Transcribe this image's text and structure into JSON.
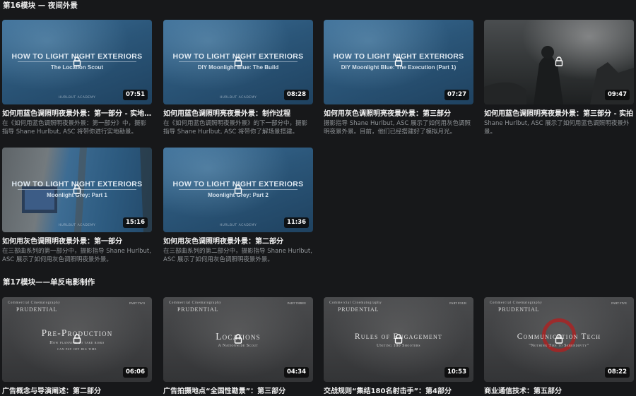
{
  "modules": [
    {
      "title": "第16模块 — 夜间外景",
      "videos": [
        {
          "title": "如何用蓝色调照明夜景外景：第一部分 - 实地勘景",
          "desc": "在《如何用蓝色调照明夜景外景：第一部分》中，摄影指导 Shane Hurlbut, ASC 将带你进行实地勘景。",
          "duration": "07:51",
          "thumb_style": "blue",
          "thumb_title": "HOW TO LIGHT NIGHT EXTERIORS",
          "thumb_sub": "The Location Scout",
          "thumb_brand": "HURLBUT ACADEMY"
        },
        {
          "title": "如何用蓝色调照明亮夜景外景：制作过程",
          "desc": "在《如何用蓝色调照明夜景外景》的下一部分中，摄影指导 Shane Hurlbut, ASC 将带你了解场景搭建。",
          "duration": "08:28",
          "thumb_style": "blue",
          "thumb_title": "HOW TO LIGHT NIGHT EXTERIORS",
          "thumb_sub": "DIY Moonlight Blue: The Build",
          "thumb_brand": "HURLBUT ACADEMY"
        },
        {
          "title": "如何用灰色调照明亮夜景外景：第三部分",
          "desc": "摄影指导 Shane Hurlbut, ASC 展示了如何用灰色调照明夜景外景。目前，他们已经搭建好了模拟月光。",
          "duration": "07:27",
          "thumb_style": "blue",
          "thumb_title": "HOW TO LIGHT NIGHT EXTERIORS",
          "thumb_sub": "DIY Moonlight Blue: The Execution (Part 1)",
          "thumb_brand": ""
        },
        {
          "title": "如何用蓝色调照明亮夜景外景：第三部分 - 实拍",
          "desc": "Shane Hurlbut, ASC 展示了如何用蓝色调照明夜景外景。",
          "duration": "09:47",
          "thumb_style": "dark",
          "thumb_title": "",
          "thumb_sub": "",
          "thumb_brand": ""
        },
        {
          "title": "如何用灰色调照明夜景外景：第一部分",
          "desc": "在三部曲系列的第一部分中，摄影指导 Shane Hurlbut, ASC 展示了如何用灰色调照明夜景外景。",
          "duration": "15:16",
          "thumb_style": "mixed",
          "thumb_title": "HOW TO LIGHT NIGHT EXTERIORS",
          "thumb_sub": "Moonlight Grey: Part 1",
          "thumb_brand": "HURLBUT ACADEMY"
        },
        {
          "title": "如何用灰色调照明夜景外景：第二部分",
          "desc": "在三部曲系列的第二部分中，摄影指导 Shane Hurlbut, ASC 展示了如何用灰色调照明夜景外景。",
          "duration": "11:36",
          "thumb_style": "blue",
          "thumb_title": "HOW TO LIGHT NIGHT EXTERIORS",
          "thumb_sub": "Moonlight Grey: Part 2",
          "thumb_brand": "HURLBUT ACADEMY"
        }
      ]
    },
    {
      "title": "第17模块——单反电影制作",
      "videos": [
        {
          "title": "广告概念与导演阐述：第二部分",
          "duration": "06:06",
          "thumb_style": "gray",
          "kicker": "Commercial Cinematography",
          "brandname": "PRUDENTIAL",
          "part": "PART TWO",
          "big": "Pre-Production",
          "small": "How planning to take risks",
          "small2": "can pay off big time"
        },
        {
          "title": "广告拍摄地点“全国性勘景”：第三部分",
          "duration": "04:34",
          "thumb_style": "gray",
          "kicker": "Commercial Cinematography",
          "brandname": "PRUDENTIAL",
          "part": "PART THREE",
          "big": "Locations",
          "small": "A Nationwide Scout",
          "small2": ""
        },
        {
          "title": "交战规则“集结180名射击手”：第4部分",
          "duration": "10:53",
          "thumb_style": "gray",
          "kicker": "Commercial Cinematography",
          "brandname": "PRUDENTIAL",
          "part": "PART FOUR",
          "big": "Rules of Engagement",
          "small": "Uniting 180 Shooters",
          "small2": ""
        },
        {
          "title": "商业通信技术：第五部分",
          "duration": "08:22",
          "thumb_style": "gray",
          "kicker": "Commercial Cinematography",
          "brandname": "PRUDENTIAL",
          "part": "PART FIVE",
          "big": "Communication Tech",
          "small": "\"Nothing Ties to Serendipity\"",
          "small2": ""
        }
      ]
    }
  ]
}
